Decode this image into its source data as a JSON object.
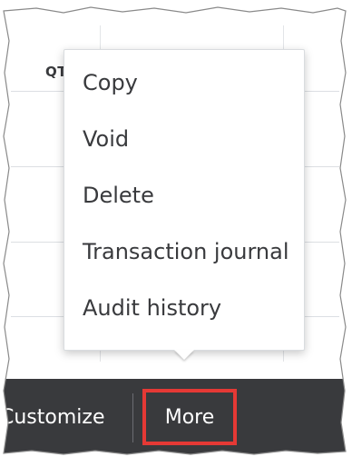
{
  "table": {
    "column_header": "QT"
  },
  "more_menu": {
    "items": [
      {
        "label": "Copy"
      },
      {
        "label": "Void"
      },
      {
        "label": "Delete"
      },
      {
        "label": "Transaction journal"
      },
      {
        "label": "Audit history"
      }
    ]
  },
  "footer": {
    "customize_label": "Customize",
    "more_label": "More"
  },
  "colors": {
    "footer_background": "#393a3d",
    "highlight_box": "#e53935",
    "menu_text": "#393a3d"
  }
}
